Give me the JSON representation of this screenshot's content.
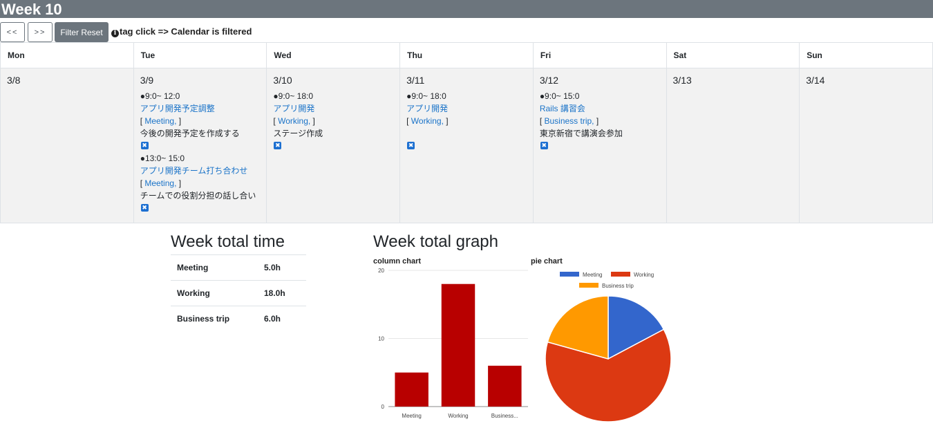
{
  "header": {
    "title": "Week 10"
  },
  "toolbar": {
    "prev_label": "<<",
    "next_label": ">>",
    "reset_label": "Filter Reset",
    "hint_text": "tag click => Calendar is filtered"
  },
  "calendar": {
    "days": [
      {
        "name": "Mon",
        "date": "3/8",
        "events": []
      },
      {
        "name": "Tue",
        "date": "3/9",
        "events": [
          {
            "time": "●9:0~ 12:0",
            "title": "アプリ開発予定調整",
            "tag": "Meeting,",
            "desc": "今後の開発予定を作成する"
          },
          {
            "time": "●13:0~ 15:0",
            "title": "アプリ開発チーム打ち合わせ",
            "tag": "Meeting,",
            "desc": "チームでの役割分担の話し合い"
          }
        ]
      },
      {
        "name": "Wed",
        "date": "3/10",
        "events": [
          {
            "time": "●9:0~ 18:0",
            "title": "アプリ開発",
            "tag": "Working,",
            "desc": "ステージ作成"
          }
        ]
      },
      {
        "name": "Thu",
        "date": "3/11",
        "events": [
          {
            "time": "●9:0~ 18:0",
            "title": "アプリ開発",
            "tag": "Working,",
            "desc": ""
          }
        ]
      },
      {
        "name": "Fri",
        "date": "3/12",
        "events": [
          {
            "time": "●9:0~ 15:0",
            "title": "Rails 講習会",
            "tag": "Business trip,",
            "desc": "東京新宿で講演会参加"
          }
        ]
      },
      {
        "name": "Sat",
        "date": "3/13",
        "events": []
      },
      {
        "name": "Sun",
        "date": "3/14",
        "events": []
      }
    ]
  },
  "totals": {
    "title": "Week total time",
    "rows": [
      {
        "label": "Meeting",
        "value": "5.0h"
      },
      {
        "label": "Working",
        "value": "18.0h"
      },
      {
        "label": "Business trip",
        "value": "6.0h"
      }
    ]
  },
  "graph": {
    "title": "Week total graph",
    "column_label": "column chart",
    "pie_label": "pie chart"
  },
  "chart_data": [
    {
      "type": "bar",
      "title": "column chart",
      "categories": [
        "Meeting",
        "Working",
        "Business..."
      ],
      "values": [
        5,
        18,
        6
      ],
      "ylim": [
        0,
        20
      ],
      "yticks": [
        0,
        10,
        20
      ],
      "color": "#b80000",
      "grid": true,
      "legend": "none"
    },
    {
      "type": "pie",
      "title": "pie chart",
      "labels": [
        "Meeting",
        "Working",
        "Business trip"
      ],
      "values": [
        5,
        18,
        6
      ],
      "colors": [
        "#3366cc",
        "#dc3912",
        "#ff9900"
      ],
      "legend": "top"
    }
  ]
}
